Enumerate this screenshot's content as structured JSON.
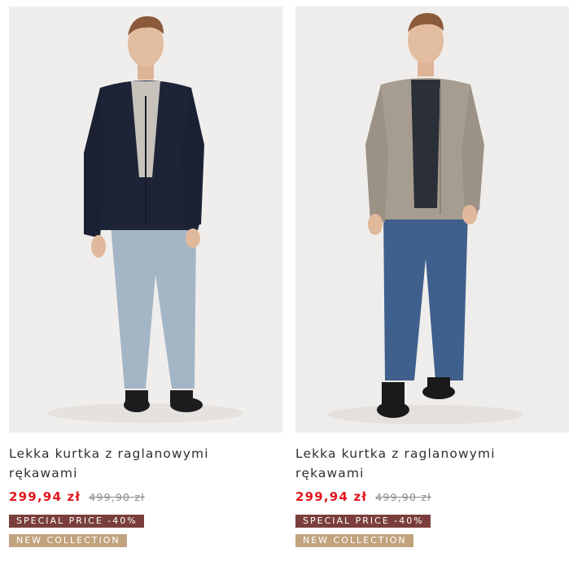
{
  "products": [
    {
      "name": "Lekka kurtka z raglanowymi rękawami",
      "price": "299,94 zł",
      "old_price": "499,90 zł",
      "badges": [
        "SPECIAL PRICE -40%",
        "NEW COLLECTION"
      ],
      "jacket_color": "#1e2437",
      "jeans_color": "#a4b5c6",
      "tee_color": "#c7c2bc"
    },
    {
      "name": "Lekka kurtka z raglanowymi rękawami",
      "price": "299,94 zł",
      "old_price": "499,90 zł",
      "badges": [
        "SPECIAL PRICE -40%",
        "NEW COLLECTION"
      ],
      "jacket_color": "#a79c90",
      "jeans_color": "#3f5f8c",
      "tee_color": "#2b2f37"
    }
  ],
  "colors": {
    "sale_price": "#e2171f",
    "special_badge": "#7a3f3c",
    "new_collection_badge": "#c1a37e"
  }
}
